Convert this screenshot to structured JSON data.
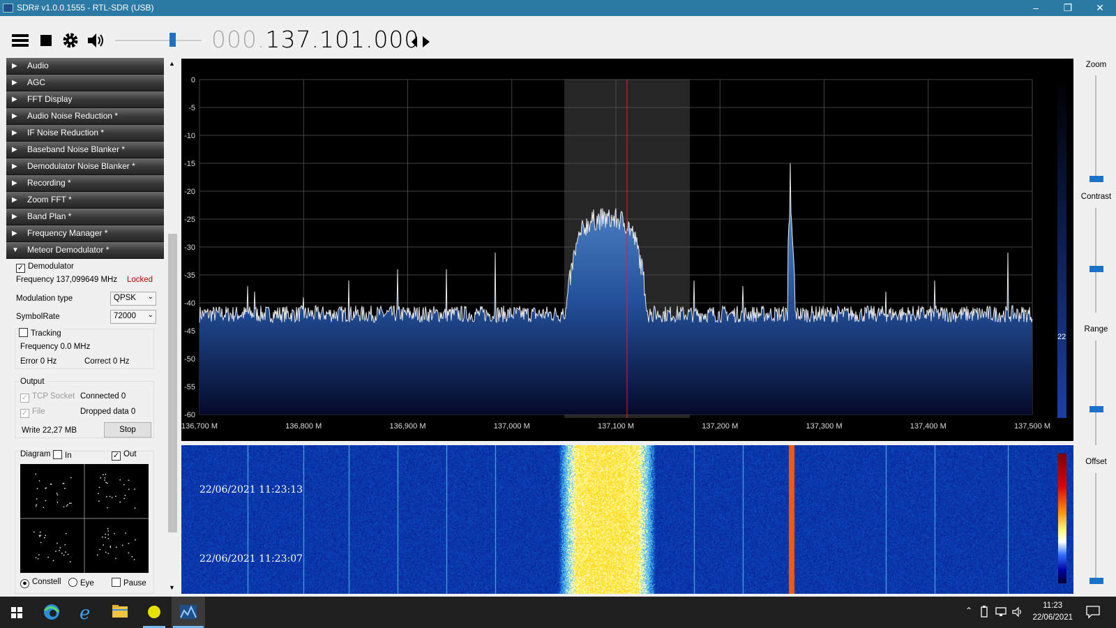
{
  "window": {
    "title": "SDR# v1.0.0.1555 - RTL-SDR (USB)"
  },
  "toolbar": {
    "freq_dim": "000.",
    "freq_main": "137.101.000"
  },
  "sections": [
    "Audio",
    "AGC",
    "FFT Display",
    "Audio Noise Reduction *",
    "IF Noise Reduction *",
    "Baseband Noise Blanker *",
    "Demodulator Noise Blanker *",
    "Recording *",
    "Zoom FFT *",
    "Band Plan *",
    "Frequency Manager *"
  ],
  "meteor": {
    "header": "Meteor Demodulator *",
    "demodulator_label": "Demodulator",
    "frequency_text": "Frequency 137,099649 MHz",
    "status": "Locked",
    "modulation_label": "Modulation type",
    "modulation_value": "QPSK",
    "symbolrate_label": "SymbolRate",
    "symbolrate_value": "72000",
    "tracking_label": "Tracking",
    "tracking_freq": "Frequency 0.0 MHz",
    "error": "Error 0 Hz",
    "correct": "Correct 0 Hz",
    "output_label": "Output",
    "tcp_label": "TCP Socket",
    "connected": "Connected 0",
    "file_label": "File",
    "dropped": "Dropped data 0",
    "write": "Write 22,27 MB",
    "stop_label": "Stop",
    "diagram_label": "Diagram",
    "in_label": "In",
    "out_label": "Out",
    "constell_label": "Constell",
    "eye_label": "Eye",
    "pause_label": "Pause"
  },
  "spectrum": {
    "y_ticks": [
      "0",
      "-5",
      "-10",
      "-15",
      "-20",
      "-25",
      "-30",
      "-35",
      "-40",
      "-45",
      "-50",
      "-55",
      "-60"
    ],
    "x_ticks": [
      "136,700 M",
      "136,800 M",
      "136,900 M",
      "137,000 M",
      "137,100 M",
      "137,200 M",
      "137,300 M",
      "137,400 M",
      "137,500 M"
    ],
    "level_value": "22"
  },
  "waterfall": {
    "timestamps": [
      "22/06/2021 11:23:13",
      "22/06/2021 11:23:07"
    ]
  },
  "right_panel": {
    "zoom": "Zoom",
    "contrast": "Contrast",
    "range": "Range",
    "offset": "Offset"
  },
  "taskbar": {
    "time": "11:23",
    "date": "22/06/2021"
  },
  "colors": {
    "titlebar": "#2b7aa5",
    "accent": "#1a73c8",
    "locked": "#c00000",
    "spectrum_fill": "#3a6fb0",
    "vfo_line": "#e02020"
  }
}
